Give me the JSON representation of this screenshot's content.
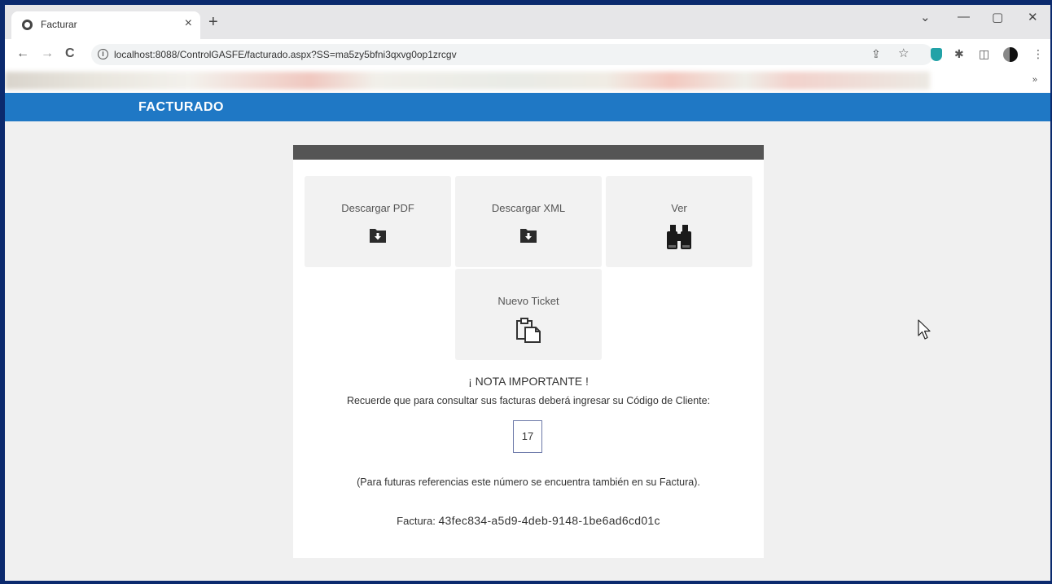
{
  "browser": {
    "tab_title": "Facturar",
    "tab_close": "×",
    "new_tab": "+",
    "url": "localhost:8088/ControlGASFE/facturado.aspx?SS=ma5zy5bfni3qxvg0op1zrcgv",
    "window_controls": {
      "dropdown": "⌄",
      "minimize": "—",
      "maximize": "▢",
      "close": "✕"
    },
    "nav": {
      "back": "←",
      "forward": "→",
      "reload": "C"
    },
    "info": "i",
    "share": "⇪",
    "star": "☆",
    "puzzle": "✱",
    "sidepanel": "◫",
    "menu": "⋮",
    "bookmarks_more": "»",
    "accent_color": "#1f78c5"
  },
  "header": {
    "title": "FACTURADO"
  },
  "actions": [
    {
      "label": "Descargar PDF",
      "icon": "folder-download-icon"
    },
    {
      "label": "Descargar XML",
      "icon": "folder-download-icon"
    },
    {
      "label": "Ver",
      "icon": "binoculars-icon"
    },
    {
      "label": "Nuevo Ticket",
      "icon": "clipboard-icon"
    }
  ],
  "note": {
    "title": "¡ NOTA IMPORTANTE !",
    "text": "Recuerde que para consultar sus facturas deberá ingresar su Código de Cliente:",
    "client_code": "17",
    "future_text": "(Para futuras referencias este número se encuentra también en su Factura).",
    "invoice_label": "Factura:",
    "invoice_id": "43fec834-a5d9-4deb-9148-1be6ad6cd01c"
  }
}
